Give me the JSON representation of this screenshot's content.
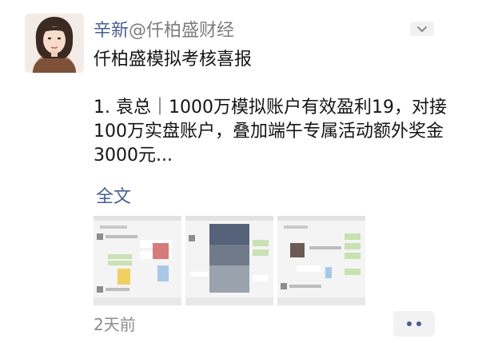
{
  "post": {
    "author": "辛新",
    "handle": "@仟柏盛财经",
    "title": "仟柏盛模拟考核喜报",
    "body": "1. 袁总｜1000万模拟账户有效盈利19，对接100万实盘账户，叠加端午专属活动额外奖金3000元...",
    "full_text_link": "全文",
    "time": "2天前"
  },
  "icons": {
    "more_top": "chevron-down-icon",
    "more_bottom": "more-dots-icon"
  },
  "colors": {
    "link": "#4a5f8f",
    "muted": "#8c8c8c",
    "button_bg": "#f2f2f2"
  }
}
